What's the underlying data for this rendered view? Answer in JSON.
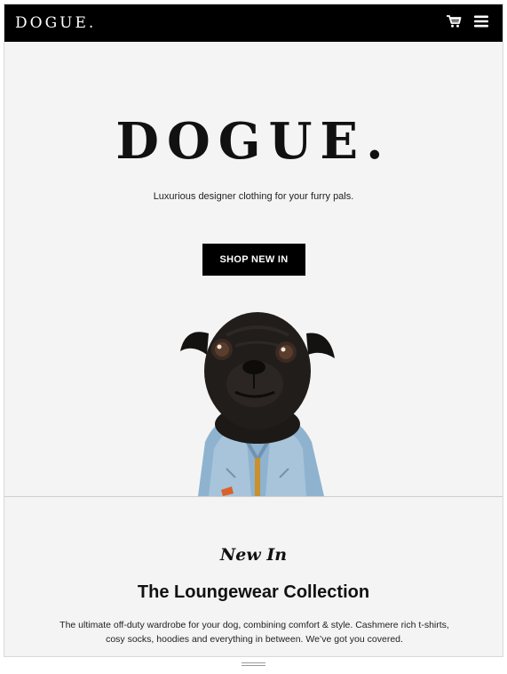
{
  "navbar": {
    "logo": "DOGUE.",
    "icons": [
      "cart-icon",
      "menu-icon"
    ]
  },
  "hero": {
    "logo": "DOGUE.",
    "tagline": "Luxurious designer clothing for your furry pals.",
    "cta_label": "SHOP NEW IN",
    "image": "pug-in-denim-jacket"
  },
  "section": {
    "eyebrow": "New In",
    "title": "The Loungewear Collection",
    "description_line1": "The ultimate off-duty wardrobe for your dog, combining comfort & style. Cashmere rich t-shirts,",
    "description_line2": "cosy socks, hoodies and everything in between. We’ve got you covered."
  },
  "colors": {
    "background": "#f4f4f4",
    "navbar": "#000000",
    "button": "#000000",
    "text": "#111111",
    "denim": "#8fb3cf"
  }
}
